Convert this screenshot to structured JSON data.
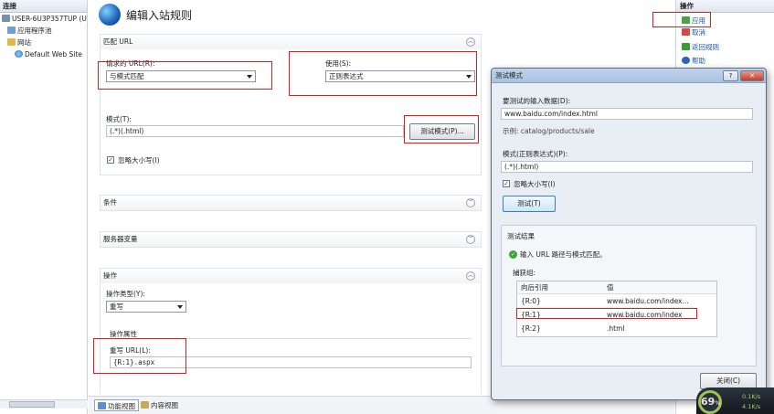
{
  "tree": {
    "header": "连接",
    "nodes": [
      "USER-6U3P357TUP (USE",
      "应用程序池",
      "网站",
      "Default Web Site"
    ]
  },
  "page": {
    "title": "编辑入站规则"
  },
  "match_url": {
    "header": "匹配 URL",
    "requested_url_label": "请求的 URL(R):",
    "requested_url_value": "与模式匹配",
    "using_label": "使用(S):",
    "using_value": "正则表达式",
    "pattern_label": "模式(T):",
    "pattern_value": "(.*)(.html)",
    "test_pattern_button": "测试模式(P)...",
    "ignore_case_label": "忽略大小写(I)",
    "ignore_case_checked": "✓"
  },
  "conditions": {
    "header": "条件"
  },
  "server_vars": {
    "header": "服务器变量"
  },
  "action": {
    "header": "操作",
    "type_label": "操作类型(Y):",
    "type_value": "重写",
    "properties_label": "操作属性",
    "rewrite_url_label": "重写 URL(L):",
    "rewrite_url_value": "{R:1}.aspx"
  },
  "bottom_tabs": {
    "features_view": "功能视图",
    "content_view": "内容视图"
  },
  "actions_panel": {
    "header": "操作",
    "items": [
      "应用",
      "取消",
      "返回规则",
      "帮助"
    ]
  },
  "dialog": {
    "title": "测试模式",
    "help_button": "?",
    "close_button": "✕",
    "input_data_label": "要测试的输入数据(D):",
    "input_data_value": "www.baidu.com/index.html",
    "example_text": "示例: catalog/products/sale",
    "pattern_label": "模式(正则表达式)(P):",
    "pattern_value": "(.*)(.html)",
    "ignore_case_label": "忽略大小写(I)",
    "ignore_case_checked": "✓",
    "test_button": "测试(T)",
    "results_label": "测试结果",
    "result_message": "输入 URL 路径与模式匹配。",
    "captures_label": "捕获组:",
    "table": {
      "headers": [
        "向后引用",
        "值"
      ],
      "rows": [
        [
          "{R:0}",
          "www.baidu.com/index..."
        ],
        [
          "{R:1}",
          "www.baidu.com/index"
        ],
        [
          "{R:2}",
          ".html"
        ]
      ]
    },
    "close_dialog_button": "关闭(C)"
  },
  "system_monitor": {
    "percent": "69",
    "percent_unit": "%",
    "up_rate": "0.1K/s",
    "down_rate": "4.1K/s"
  },
  "colors": {
    "highlight_red": "#e31b1b",
    "link_blue": "#1b55b3",
    "dialog_bg": "#e9eef5"
  }
}
